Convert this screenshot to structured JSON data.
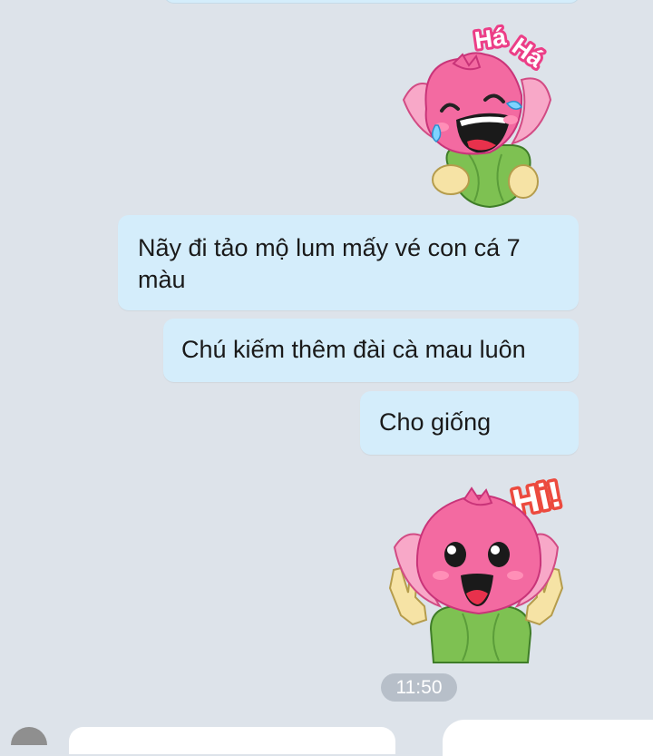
{
  "messages": [
    {
      "type": "sticker",
      "text": "Há Há",
      "icon": "laughing-lotus-sticker"
    },
    {
      "type": "text",
      "text": "Nãy đi tảo mộ lum mấy vé con cá 7 màu"
    },
    {
      "type": "text",
      "text": "Chú kiếm thêm đài cà mau luôn"
    },
    {
      "type": "text",
      "text": "Cho giống"
    },
    {
      "type": "sticker",
      "text": "Hi!",
      "icon": "waving-lotus-sticker"
    }
  ],
  "timestamp": "11:50",
  "colors": {
    "background": "#dde3ea",
    "bubble": "#d4edfb",
    "time_pill": "#b7bfc9",
    "lotus_pink": "#f36aa1",
    "leaf_green": "#7ec152"
  }
}
